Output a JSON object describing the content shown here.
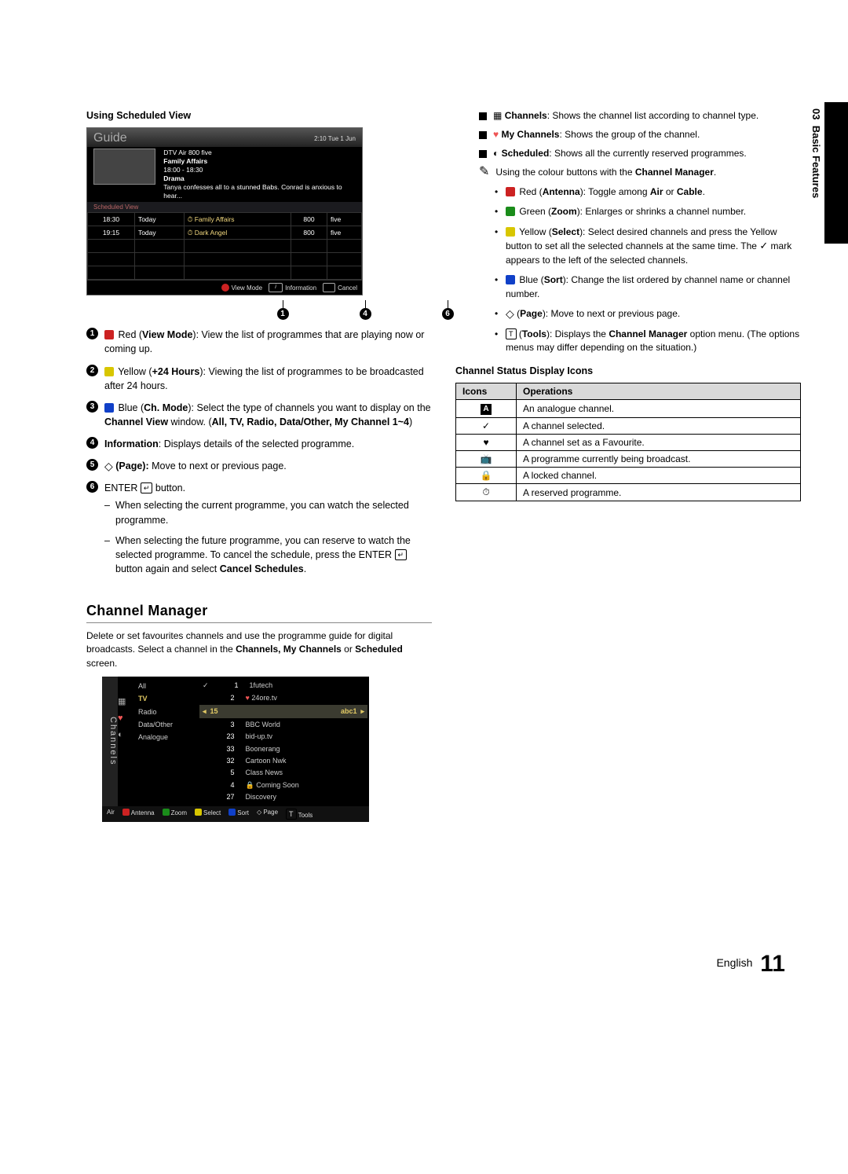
{
  "sideTab": {
    "chapter": "03",
    "title": "Basic Features"
  },
  "footer": {
    "lang": "English",
    "page": "11"
  },
  "left": {
    "scheduledHeading": "Using Scheduled View",
    "guide": {
      "title": "Guide",
      "clock": "2:10 Tue 1 Jun",
      "channelLine": "DTV Air 800 five",
      "programme": "Family Affairs",
      "time": "18:00 - 18:30",
      "genre": "Drama",
      "synopsis": "Tanya confesses all to a stunned Babs. Conrad is anxious to hear...",
      "schedRow": "Scheduled View",
      "rows": [
        {
          "t": "18:30",
          "d": "Today",
          "name": "Family Affairs",
          "num": "800",
          "ch": "five"
        },
        {
          "t": "19:15",
          "d": "Today",
          "name": "Dark Angel",
          "num": "800",
          "ch": "five"
        }
      ],
      "footer": {
        "a": "View Mode",
        "i": "Information",
        "c": "Cancel"
      }
    },
    "callouts": [
      "1",
      "4",
      "6"
    ],
    "numbered": [
      {
        "n": "1",
        "body": "Red (View Mode): View the list of programmes that are playing now or coming up.",
        "redLabel": "View Mode",
        "prefix": "Red (",
        "redStart": true
      },
      {
        "n": "2",
        "body": "Yellow (+24 Hours): Viewing the list of programmes to be broadcasted after 24 hours."
      },
      {
        "n": "3",
        "body": "Blue (Ch. Mode): Select the type of channels you want to display on the Channel View window. (All, TV, Radio, Data/Other, My Channel 1~4)"
      },
      {
        "n": "4",
        "body": "Information: Displays details of the selected programme."
      },
      {
        "n": "5",
        "body": "(Page): Move to next or previous page."
      },
      {
        "n": "6",
        "body": "ENTER  button.",
        "sub": [
          "When selecting the current programme, you can watch the selected programme.",
          "When selecting the future programme, you can reserve to watch the selected programme. To cancel the schedule, press the ENTER  button again and select Cancel Schedules."
        ]
      }
    ],
    "channelManager": {
      "heading": "Channel Manager",
      "intro": "Delete or set favourites channels and use the programme guide for digital broadcasts. Select a channel in the Channels, My Channels or Scheduled screen.",
      "side": "Channels",
      "categories": [
        "All",
        "TV",
        "Radio",
        "Data/Other",
        "Analogue"
      ],
      "top": [
        {
          "num": "1",
          "name": "1futech",
          "check": true
        },
        {
          "num": "2",
          "name": "24ore.tv",
          "heart": true
        }
      ],
      "highlight": {
        "num": "15",
        "name": "abc1"
      },
      "list": [
        {
          "num": "3",
          "name": "BBC World"
        },
        {
          "num": "23",
          "name": "bid-up.tv"
        },
        {
          "num": "33",
          "name": "Boonerang"
        },
        {
          "num": "32",
          "name": "Cartoon Nwk"
        },
        {
          "num": "5",
          "name": "Class News"
        },
        {
          "num": "4",
          "name": "Coming Soon",
          "lock": true
        },
        {
          "num": "27",
          "name": "Discovery"
        }
      ],
      "footer": [
        "Air",
        "Antenna",
        "Zoom",
        "Select",
        "Sort",
        "Page",
        "Tools"
      ]
    }
  },
  "right": {
    "squares": [
      {
        "icon": "channels",
        "text": "Channels: Shows the channel list according to channel type."
      },
      {
        "icon": "heart",
        "text": "My Channels: Shows the group of the channel."
      },
      {
        "icon": "scheduled",
        "text": "Scheduled: Shows all the currently reserved programmes."
      }
    ],
    "note": "Using the colour buttons with the Channel Manager.",
    "colourButtons": [
      {
        "color": "red",
        "label": "Red (Antenna)",
        "rest": ": Toggle among Air or Cable."
      },
      {
        "color": "green",
        "label": "Green (Zoom)",
        "rest": ": Enlarges or shrinks a channel number."
      },
      {
        "color": "yellow",
        "label": "Yellow (Select)",
        "rest": ": Select desired channels and press the Yellow button to set all the selected channels at the same time. The ✓ mark appears to the left of the selected channels."
      },
      {
        "color": "blue",
        "label": "Blue (Sort)",
        "rest": ": Change the list ordered by channel name or channel number."
      },
      {
        "color": "page",
        "label": "(Page)",
        "rest": ": Move to next or previous page."
      },
      {
        "color": "tools",
        "label": "(Tools)",
        "rest": ": Displays the Channel Manager option menu. (The options menus may differ depending on the situation.)"
      }
    ],
    "iconsHeading": "Channel Status Display Icons",
    "iconsTable": {
      "h1": "Icons",
      "h2": "Operations",
      "rows": [
        {
          "icon": "A",
          "op": "An analogue channel."
        },
        {
          "icon": "✓",
          "op": "A channel selected."
        },
        {
          "icon": "♥",
          "op": "A channel set as a Favourite."
        },
        {
          "icon": "📺",
          "op": "A programme currently being broadcast."
        },
        {
          "icon": "🔒",
          "op": "A locked channel."
        },
        {
          "icon": "⏱",
          "op": "A reserved programme."
        }
      ]
    }
  }
}
